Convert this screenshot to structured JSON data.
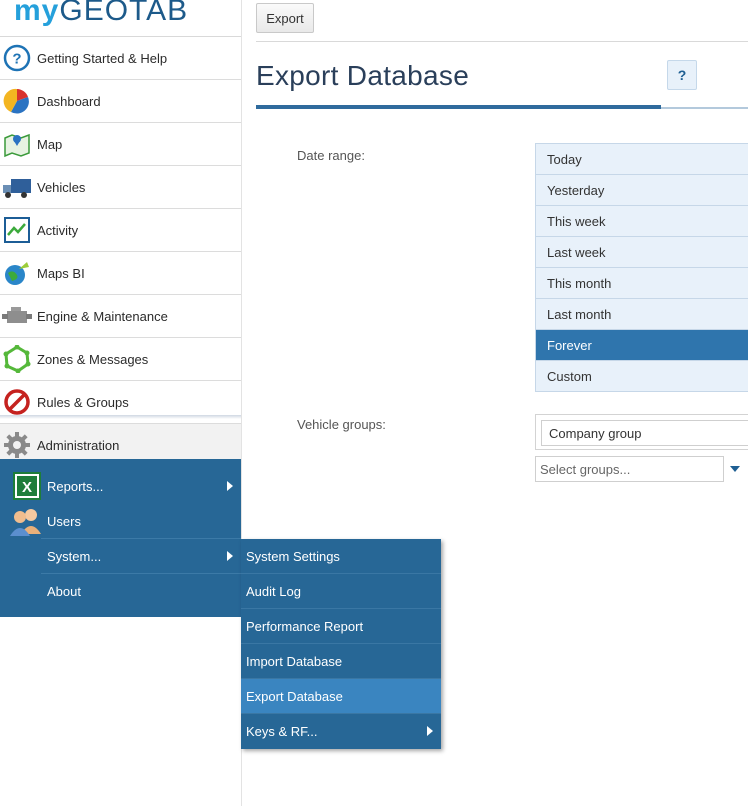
{
  "logo": {
    "my": "my",
    "geotab": "GEOTAB"
  },
  "sidebar": {
    "items": [
      {
        "label": "Getting Started & Help",
        "icon": "help-icon"
      },
      {
        "label": "Dashboard",
        "icon": "dashboard-icon"
      },
      {
        "label": "Map",
        "icon": "map-icon"
      },
      {
        "label": "Vehicles",
        "icon": "truck-icon"
      },
      {
        "label": "Activity",
        "icon": "activity-icon"
      },
      {
        "label": "Maps BI",
        "icon": "maps-bi-icon"
      },
      {
        "label": "Engine & Maintenance",
        "icon": "engine-icon"
      },
      {
        "label": "Zones & Messages",
        "icon": "zones-icon"
      },
      {
        "label": "Rules & Groups",
        "icon": "rules-icon"
      },
      {
        "label": "Administration",
        "icon": "gear-icon"
      }
    ]
  },
  "admin_menu": {
    "items": [
      {
        "label": "Reports...",
        "icon": "excel-icon"
      },
      {
        "label": "Users",
        "icon": "users-icon"
      },
      {
        "label": "System..."
      },
      {
        "label": "About"
      }
    ]
  },
  "system_menu": {
    "items": [
      {
        "label": "System Settings"
      },
      {
        "label": "Audit Log"
      },
      {
        "label": "Performance Report"
      },
      {
        "label": "Import Database"
      },
      {
        "label": "Export Database"
      },
      {
        "label": "Keys & RF..."
      }
    ],
    "active": "Export Database"
  },
  "toolbar": {
    "export_label": "Export"
  },
  "page": {
    "title": "Export Database",
    "help_label": "?"
  },
  "form": {
    "date_range_label": "Date range:",
    "date_ranges": [
      "Today",
      "Yesterday",
      "This week",
      "Last week",
      "This month",
      "Last month",
      "Forever",
      "Custom"
    ],
    "selected_range": "Forever",
    "vehicle_groups_label": "Vehicle groups:",
    "selected_group": "Company group",
    "group_placeholder": "Select groups..."
  },
  "colors": {
    "accent": "#276796",
    "selected": "#2f75ad",
    "title": "#2a3f5a"
  }
}
